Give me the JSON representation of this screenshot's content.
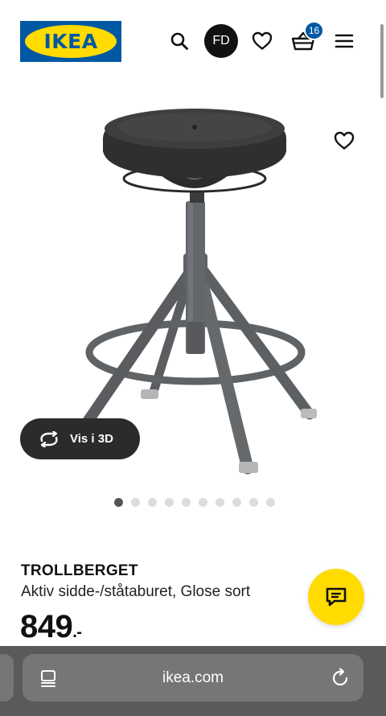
{
  "header": {
    "logo_text": "IKEA",
    "avatar_initials": "FD",
    "cart_count": "16",
    "icons": [
      "search-icon",
      "heart-icon",
      "basket-icon",
      "menu-icon"
    ]
  },
  "gallery": {
    "view_3d_label": "Vis i 3D",
    "dot_count": 10,
    "active_dot": 1
  },
  "product": {
    "name": "TROLLBERGET",
    "description": "Aktiv sidde-/ståtaburet, Glose sort",
    "price": "849",
    "price_suffix": ".-"
  },
  "browser": {
    "url": "ikea.com"
  },
  "colors": {
    "ikea_blue": "#0058a3",
    "ikea_yellow": "#ffdb00",
    "dark_pill": "#2b2b2b",
    "browser_bar": "#5a5a5a"
  }
}
